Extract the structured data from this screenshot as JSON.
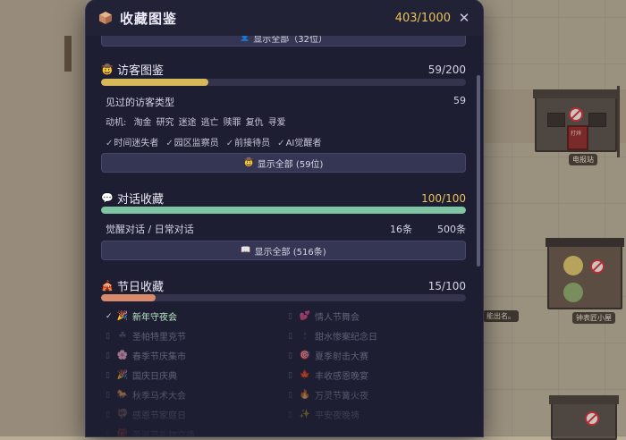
{
  "header": {
    "title": "收藏图鉴",
    "count": "403/1000",
    "icon": "box-icon",
    "close_label": "✕"
  },
  "top_button": {
    "label": "显示全部（32位）"
  },
  "visitors": {
    "title": "访客图鉴",
    "count": "59/200",
    "progress": 0.295,
    "seen_label": "见过的访客类型",
    "seen_value": "59",
    "motives_label": "动机:",
    "motives": [
      "淘金",
      "研究",
      "迷途",
      "逃亡",
      "赎罪",
      "复仇",
      "寻爱"
    ],
    "specials": [
      "时间迷失者",
      "园区监察员",
      "前接待员",
      "AI觉醒者"
    ],
    "button_label": "显示全部 (59位)"
  },
  "dialogs": {
    "title": "对话收藏",
    "count": "100/100",
    "progress": 1.0,
    "type_label": "觉醒对话 / 日常对话",
    "awaken_value": "16条",
    "daily_value": "500条",
    "button_label": "显示全部 (516条)"
  },
  "festivals": {
    "title": "节日收藏",
    "count": "15/100",
    "progress": 0.15,
    "items": [
      {
        "name": "新年守夜会",
        "icon": "🎉",
        "unlocked": true
      },
      {
        "name": "情人节舞会",
        "icon": "💕",
        "unlocked": false
      },
      {
        "name": "圣帕特里克节",
        "icon": "☘",
        "unlocked": false
      },
      {
        "name": "甜水惨案纪念日",
        "icon": "🕯",
        "unlocked": false
      },
      {
        "name": "春季节庆集市",
        "icon": "🌸",
        "unlocked": false
      },
      {
        "name": "夏季射击大赛",
        "icon": "🎯",
        "unlocked": false
      },
      {
        "name": "国庆日庆典",
        "icon": "🎉",
        "unlocked": false
      },
      {
        "name": "丰收感恩晚宴",
        "icon": "🍁",
        "unlocked": false
      },
      {
        "name": "秋季马术大会",
        "icon": "🐎",
        "unlocked": false
      },
      {
        "name": "万灵节篝火夜",
        "icon": "🔥",
        "unlocked": false
      },
      {
        "name": "感恩节家庭日",
        "icon": "🦃",
        "unlocked": false
      },
      {
        "name": "平安夜晚祷",
        "icon": "✨",
        "unlocked": false
      },
      {
        "name": "圣诞节礼物交换",
        "icon": "🎁",
        "unlocked": false
      }
    ]
  },
  "world": {
    "building_telegraph": "电报站",
    "building_clock": "钟表匠小屋",
    "hint_text": "能出名。",
    "shop_text": "打烊"
  },
  "colors": {
    "panel_bg": "#1e1e32",
    "gold": "#e9c25a",
    "visitor_bar": "#d8b95a",
    "dialog_bar": "#7fc4a3",
    "festival_bar": "#d98a6a"
  }
}
